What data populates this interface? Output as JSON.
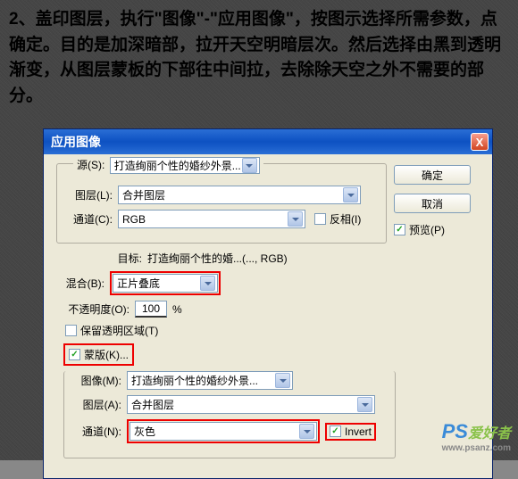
{
  "instruction_text": "2、盖印图层，执行\"图像\"-\"应用图像\"，按图示选择所需参数，点确定。目的是加深暗部，拉开天空明暗层次。然后选择由黑到透明渐变，从图层蒙板的下部往中间拉，去除除天空之外不需要的部分。",
  "dialog": {
    "title": "应用图像",
    "close_x": "X",
    "source_legend": "源(S):",
    "source_value": "打造绚丽个性的婚纱外景...",
    "layer_label": "图层(L):",
    "layer_value": "合并图层",
    "channel_label": "通道(C):",
    "channel_value": "RGB",
    "invert1_label": "反相(I)",
    "target_label": "目标:",
    "target_value": "打造绚丽个性的婚...(..., RGB)",
    "blend_label": "混合(B):",
    "blend_value": "正片叠底",
    "opacity_label": "不透明度(O):",
    "opacity_value": "100",
    "opacity_unit": "%",
    "preserve_trans": "保留透明区域(T)",
    "mask_label": "蒙版(K)...",
    "image_label": "图像(M):",
    "image_value": "打造绚丽个性的婚纱外景...",
    "layer2_label": "图层(A):",
    "layer2_value": "合并图层",
    "channel2_label": "通道(N):",
    "channel2_value": "灰色",
    "invert2_label": "Invert",
    "ok_btn": "确定",
    "cancel_btn": "取消",
    "preview_label": "预览(P)"
  },
  "watermark": {
    "ps": "PS",
    "txt": "爱好者",
    "url": "www.psanz.com"
  }
}
